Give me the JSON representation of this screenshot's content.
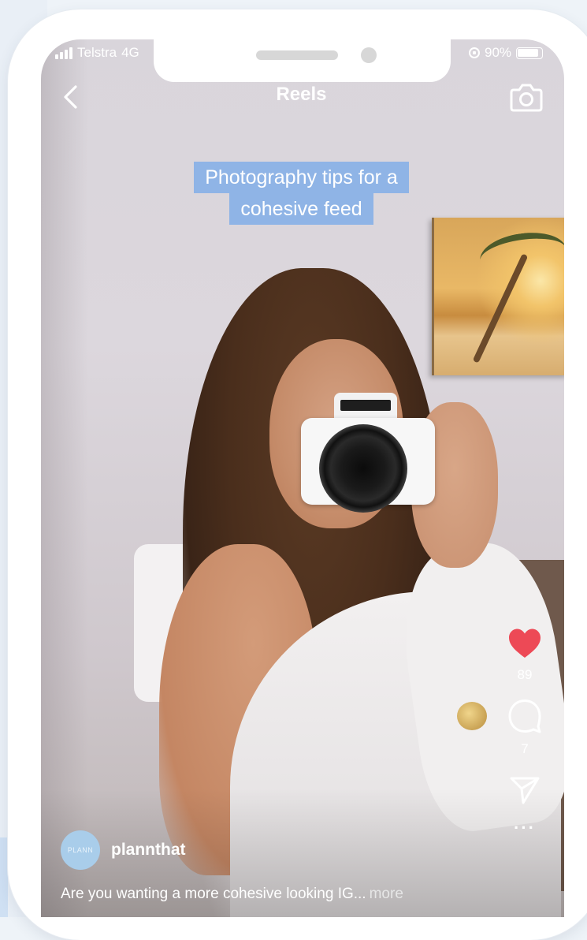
{
  "status_bar": {
    "carrier": "Telstra",
    "network": "4G",
    "battery_text": "90%",
    "battery_level": 0.9
  },
  "header": {
    "title": "Reels"
  },
  "video_caption": {
    "line1": "Photography tips for a",
    "line2": "cohesive feed"
  },
  "actions": {
    "likes": "89",
    "comments": "7"
  },
  "post": {
    "avatar_text": "PLANN",
    "username": "plannthat",
    "description": "Are you wanting a more cohesive looking IG...",
    "more_label": "more"
  },
  "colors": {
    "caption_bg": "#8fb4e6",
    "heart": "#ed4956",
    "avatar_bg": "#a9cdea"
  },
  "icons": [
    "back-chevron-icon",
    "camera-icon",
    "heart-icon",
    "comment-icon",
    "send-icon",
    "more-dots-icon"
  ]
}
